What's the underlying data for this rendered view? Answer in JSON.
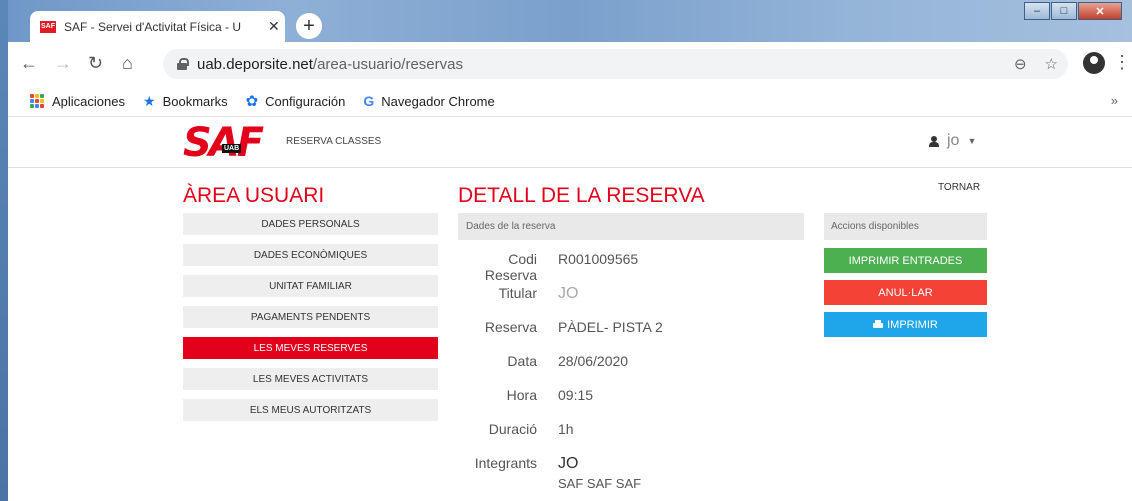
{
  "browser": {
    "tab": {
      "favicon_text": "SAF",
      "title": "SAF - Servei d'Activitat Física - U"
    },
    "new_tab_label": "+",
    "url_host": "uab.deporsite.net",
    "url_path": "/area-usuario/reservas",
    "bookmarks": [
      {
        "label": "Aplicaciones",
        "icon": "apps-grid-icon"
      },
      {
        "label": "Bookmarks",
        "icon": "star-icon"
      },
      {
        "label": "Configuración",
        "icon": "gear-icon"
      },
      {
        "label": "Navegador Chrome",
        "icon": "google-icon"
      }
    ],
    "bookmarks_overflow": "»"
  },
  "header": {
    "logo_text": "SAF",
    "logo_badge": "UAB",
    "nav_link": "RESERVA CLASSES",
    "user_name": "jo"
  },
  "sidebar": {
    "title": "ÀREA USUARI",
    "items": [
      {
        "label": "DADES PERSONALS",
        "active": false
      },
      {
        "label": "DADES ECONÒMIQUES",
        "active": false
      },
      {
        "label": "UNITAT FAMILIAR",
        "active": false
      },
      {
        "label": "PAGAMENTS PENDENTS",
        "active": false
      },
      {
        "label": "LES MEVES RESERVES",
        "active": true
      },
      {
        "label": "LES MEVES ACTIVITATS",
        "active": false
      },
      {
        "label": "ELS MEUS AUTORITZATS",
        "active": false
      }
    ]
  },
  "detail": {
    "title": "DETALL DE LA RESERVA",
    "section_label": "Dades de la reserva",
    "rows": [
      {
        "label": "Codi Reserva",
        "value": "R001009565"
      },
      {
        "label": "Titular",
        "value": "JO"
      },
      {
        "label": "Reserva",
        "value": "PÀDEL- PISTA 2"
      },
      {
        "label": "Data",
        "value": "28/06/2020"
      },
      {
        "label": "Hora",
        "value": "09:15"
      },
      {
        "label": "Duració",
        "value": "1h"
      },
      {
        "label": "Integrants",
        "value": "JO",
        "sub": "SAF SAF SAF"
      }
    ]
  },
  "actions": {
    "back_label": "TORNAR",
    "section_label": "Accions disponibles",
    "print_tickets": "IMPRIMIR ENTRADES",
    "cancel": "ANUL·LAR",
    "print": "IMPRIMIR"
  },
  "colors": {
    "brand_red": "#e3001b",
    "green": "#4caf50",
    "red": "#f44336",
    "blue": "#1ea5ea"
  }
}
